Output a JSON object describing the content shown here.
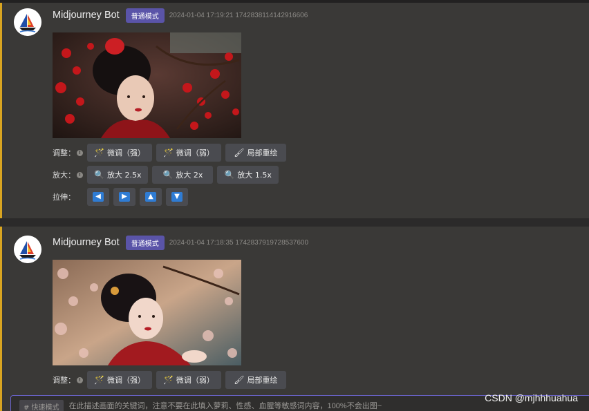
{
  "messages": [
    {
      "bot_name": "Midjourney Bot",
      "badge": "普通模式",
      "meta": "2024-01-04 17:19:21 1742838114142916606",
      "image_alt": "woman in red with plum blossoms",
      "rows": [
        {
          "label": "调整：",
          "buttons": [
            {
              "icon": "magic-wand-icon",
              "text": "微调（强）"
            },
            {
              "icon": "magic-wand-icon",
              "text": "微调（弱）"
            },
            {
              "icon": "brush-icon",
              "text": "局部重绘"
            }
          ]
        },
        {
          "label": "放大：",
          "buttons": [
            {
              "icon": "magnifier-icon",
              "text": "放大 2.5x"
            },
            {
              "icon": "magnifier-icon",
              "text": "放大 2x"
            },
            {
              "icon": "magnifier-icon",
              "text": "放大 1.5x"
            }
          ]
        },
        {
          "label": "拉伸：",
          "arrows": [
            "left",
            "right",
            "up",
            "down"
          ]
        }
      ]
    },
    {
      "bot_name": "Midjourney Bot",
      "badge": "普通模式",
      "meta": "2024-01-04 17:18:35 1742837919728537600",
      "image_alt": "woman in red with cherry blossoms",
      "rows": [
        {
          "label": "调整：",
          "buttons": [
            {
              "icon": "magic-wand-icon",
              "text": "微调（强）"
            },
            {
              "icon": "magic-wand-icon",
              "text": "微调（弱）"
            },
            {
              "icon": "brush-icon",
              "text": "局部重绘"
            }
          ]
        }
      ]
    }
  ],
  "input": {
    "mode_tag": "# 快速模式",
    "placeholder": "在此描述画面的关键词，注意不要在此填入萝莉、性感、血腥等敏感词内容，100%不会出图~"
  },
  "watermark": "CSDN @mjhhhuahua",
  "colors": {
    "accent": "#d9a521",
    "badge": "#5a54a8",
    "input_border": "#6a63c9",
    "arrow": "#2f7cd4"
  }
}
